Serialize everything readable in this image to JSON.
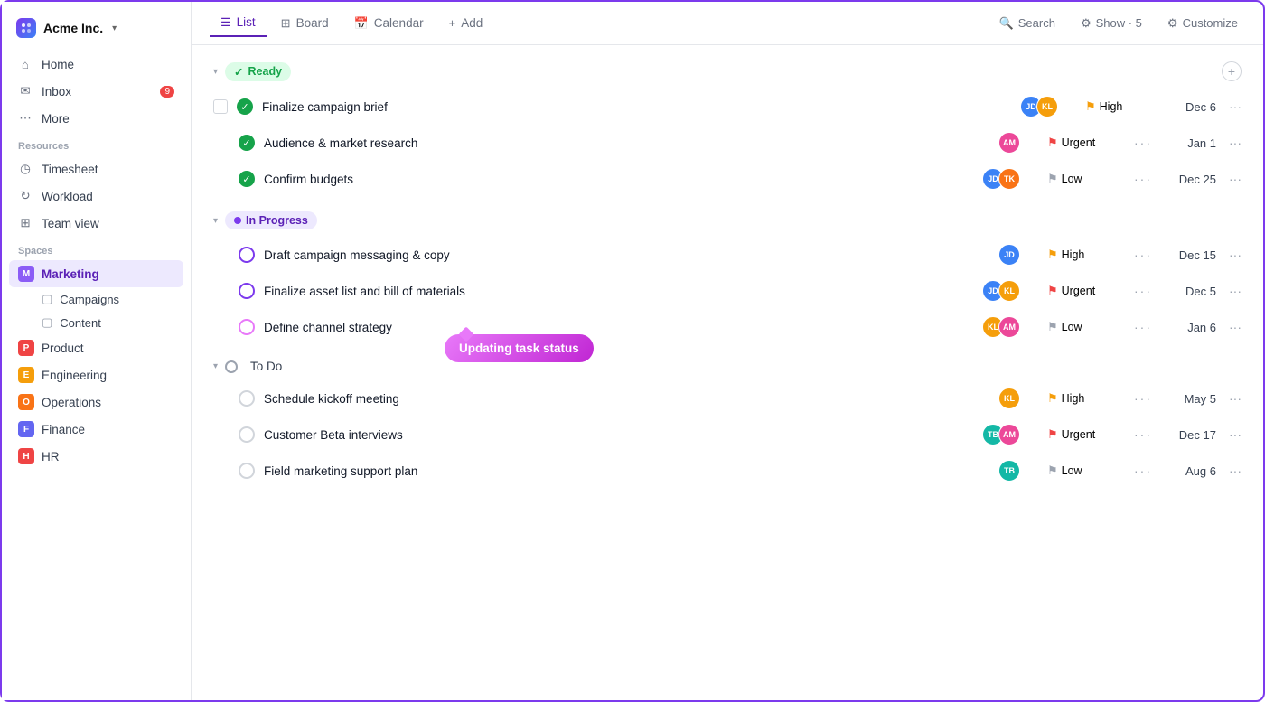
{
  "brand": {
    "name": "Acme Inc.",
    "chevron": "▾"
  },
  "nav": {
    "home": "Home",
    "inbox": "Inbox",
    "inbox_badge": "9",
    "more": "More"
  },
  "resources": {
    "label": "Resources",
    "timesheet": "Timesheet",
    "workload": "Workload",
    "team_view": "Team view"
  },
  "spaces": {
    "label": "Spaces",
    "items": [
      {
        "id": "marketing",
        "label": "Marketing",
        "color": "#8b5cf6",
        "letter": "M",
        "active": true
      },
      {
        "id": "product",
        "label": "Product",
        "color": "#ef4444",
        "letter": "P",
        "active": false
      },
      {
        "id": "engineering",
        "label": "Engineering",
        "color": "#f59e0b",
        "letter": "E",
        "active": false
      },
      {
        "id": "operations",
        "label": "Operations",
        "color": "#f97316",
        "letter": "O",
        "active": false
      },
      {
        "id": "finance",
        "label": "Finance",
        "color": "#6366f1",
        "letter": "F",
        "active": false
      },
      {
        "id": "hr",
        "label": "HR",
        "color": "#ef4444",
        "letter": "H",
        "active": false
      }
    ],
    "sub_items": [
      "Campaigns",
      "Content"
    ]
  },
  "topbar": {
    "tabs": [
      {
        "id": "list",
        "label": "List",
        "active": true
      },
      {
        "id": "board",
        "label": "Board",
        "active": false
      },
      {
        "id": "calendar",
        "label": "Calendar",
        "active": false
      },
      {
        "id": "add",
        "label": "Add",
        "active": false
      }
    ],
    "search": "Search",
    "show": "Show · 5",
    "customize": "Customize"
  },
  "sections": {
    "ready": {
      "label": "Ready",
      "tasks": [
        {
          "name": "Finalize campaign brief",
          "avatars": [
            "av-blue",
            "av-yellow"
          ],
          "priority": "High",
          "priority_class": "high",
          "due": "Dec 6",
          "has_checkbox": true
        },
        {
          "name": "Audience & market research",
          "avatars": [
            "av-pink"
          ],
          "priority": "Urgent",
          "priority_class": "urgent",
          "due": "Jan 1"
        },
        {
          "name": "Confirm budgets",
          "avatars": [
            "av-blue",
            "av-orange"
          ],
          "priority": "Low",
          "priority_class": "low",
          "due": "Dec 25"
        }
      ]
    },
    "in_progress": {
      "label": "In Progress",
      "tasks": [
        {
          "name": "Draft campaign messaging & copy",
          "avatars": [
            "av-blue"
          ],
          "priority": "High",
          "priority_class": "high",
          "due": "Dec 15"
        },
        {
          "name": "Finalize asset list and bill of materials",
          "avatars": [
            "av-blue",
            "av-yellow"
          ],
          "priority": "Urgent",
          "priority_class": "urgent",
          "due": "Dec 5"
        },
        {
          "name": "Define channel strategy",
          "avatars": [
            "av-yellow",
            "av-pink"
          ],
          "priority": "Low",
          "priority_class": "low",
          "due": "Jan 6",
          "has_tooltip": true
        }
      ],
      "tooltip": "Updating task status"
    },
    "todo": {
      "label": "To Do",
      "tasks": [
        {
          "name": "Schedule kickoff meeting",
          "avatars": [
            "av-yellow"
          ],
          "priority": "High",
          "priority_class": "high",
          "due": "May 5"
        },
        {
          "name": "Customer Beta interviews",
          "avatars": [
            "av-teal",
            "av-pink"
          ],
          "priority": "Urgent",
          "priority_class": "urgent",
          "due": "Dec 17"
        },
        {
          "name": "Field marketing support plan",
          "avatars": [
            "av-teal"
          ],
          "priority": "Low",
          "priority_class": "low",
          "due": "Aug 6"
        }
      ]
    }
  }
}
